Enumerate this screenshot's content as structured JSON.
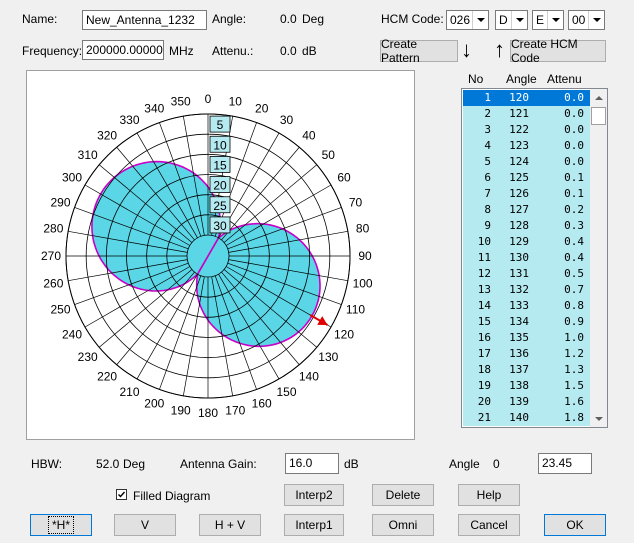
{
  "top": {
    "name_label": "Name:",
    "name_value": "New_Antenna_1232",
    "angle_label": "Angle:",
    "angle_value": "0.0",
    "angle_unit": "Deg",
    "hcm_label": "HCM Code:",
    "hcm_codes": [
      "026",
      "D",
      "E",
      "00"
    ],
    "frequency_label": "Frequency:",
    "frequency_value": "200000.000000",
    "frequency_unit": "MHz",
    "attenu_label": "Attenu.:",
    "attenu_value": "0.0",
    "attenu_unit": "dB",
    "create_pattern": "Create Pattern",
    "create_hcm": "Create HCM Code",
    "down_arrow": "↓",
    "up_arrow": "↑"
  },
  "table": {
    "headers": [
      "No",
      "Angle",
      "Attenu"
    ],
    "rows": [
      [
        "1",
        "120",
        "0.0"
      ],
      [
        "2",
        "121",
        "0.0"
      ],
      [
        "3",
        "122",
        "0.0"
      ],
      [
        "4",
        "123",
        "0.0"
      ],
      [
        "5",
        "124",
        "0.0"
      ],
      [
        "6",
        "125",
        "0.1"
      ],
      [
        "7",
        "126",
        "0.1"
      ],
      [
        "8",
        "127",
        "0.2"
      ],
      [
        "9",
        "128",
        "0.3"
      ],
      [
        "10",
        "129",
        "0.4"
      ],
      [
        "11",
        "130",
        "0.4"
      ],
      [
        "12",
        "131",
        "0.5"
      ],
      [
        "13",
        "132",
        "0.7"
      ],
      [
        "14",
        "133",
        "0.8"
      ],
      [
        "15",
        "134",
        "0.9"
      ],
      [
        "16",
        "135",
        "1.0"
      ],
      [
        "17",
        "136",
        "1.2"
      ],
      [
        "18",
        "137",
        "1.3"
      ],
      [
        "19",
        "138",
        "1.5"
      ],
      [
        "20",
        "139",
        "1.6"
      ],
      [
        "21",
        "140",
        "1.8"
      ]
    ],
    "selected_index": 0
  },
  "polar": {
    "angle_labels": [
      "0",
      "10",
      "20",
      "30",
      "40",
      "50",
      "60",
      "70",
      "80",
      "90",
      "100",
      "110",
      "120",
      "130",
      "140",
      "150",
      "160",
      "170",
      "180",
      "190",
      "200",
      "210",
      "220",
      "230",
      "240",
      "250",
      "260",
      "270",
      "280",
      "290",
      "300",
      "310",
      "320",
      "330",
      "340",
      "350"
    ],
    "radial_labels": [
      "5",
      "10",
      "15",
      "20",
      "25",
      "30"
    ],
    "fill_color": "#5ad6e6",
    "outline_color": "#c800c8",
    "marker_color": "#e00000",
    "marker_angle": 120
  },
  "bottom": {
    "hbw_label": "HBW:",
    "hbw_value": "52.0",
    "hbw_unit": "Deg",
    "gain_label": "Antenna Gain:",
    "gain_value": "16.0",
    "gain_unit": "dB",
    "angle_label": "Angle",
    "angle_value": "0",
    "angle_input": "23.45",
    "filled_label": "Filled Diagram",
    "filled_checked": true,
    "interp2": "Interp2",
    "delete": "Delete",
    "help": "Help",
    "h_btn": "*H*",
    "v_btn": "V",
    "hv_btn": "H + V",
    "interp1": "Interp1",
    "omni": "Omni",
    "cancel": "Cancel",
    "ok": "OK"
  }
}
